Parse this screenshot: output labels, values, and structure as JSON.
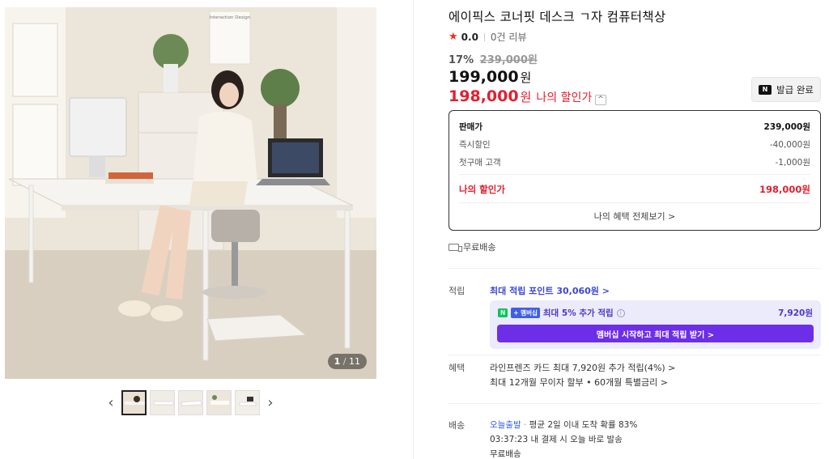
{
  "product": {
    "title": "에이픽스 코너핏 데스크 ㄱ자 컴퓨터책상",
    "rating_star": "★",
    "rating": "0.0",
    "reviews": "0건 리뷰",
    "discount_rate": "17%",
    "original_price": "239,000원",
    "price": "199,000",
    "price_unit": "원",
    "my_price": "198,000",
    "my_price_unit": "원",
    "my_price_label": "나의 할인가",
    "my_price_caret": "^"
  },
  "coupon": {
    "icon": "N",
    "label": "발급 완료"
  },
  "price_box": {
    "rows": [
      {
        "label": "판매가",
        "value": "239,000원"
      },
      {
        "label": "즉시할인",
        "value": "-40,000원"
      },
      {
        "label": "첫구매 고객",
        "value": "-1,000원"
      }
    ],
    "total_label": "나의 할인가",
    "total_value": "198,000원",
    "more_link": "나의 혜택 전체보기 >"
  },
  "shipping_top": "무료배송",
  "points": {
    "label": "적립",
    "max_link": "최대 적립 포인트 30,060원 >",
    "badge_n": "N",
    "badge_plus": "+ 멤버십",
    "member_text": "최대 5% 추가 적립",
    "member_info": "i",
    "member_amount": "7,920원",
    "member_button": "멤버십 시작하고 최대 적립 받기 >"
  },
  "benefits": {
    "label": "혜택",
    "lines": [
      "라인프렌즈 카드 최대 7,920원 추가 적립(4%) >",
      "최대 12개월 무이자 할부 • 60개월 특별금리 >"
    ]
  },
  "delivery": {
    "label": "배송",
    "type": "오늘출발",
    "dot": "·",
    "eta": "평균 2일 이내 도착 확률 83%",
    "countdown": "03:37:23",
    "countdown_text": "내 결제 시 오늘 바로 발송",
    "free": "무료배송"
  },
  "gallery": {
    "current": "1",
    "separator": "/",
    "total": "11",
    "prev": "‹",
    "next": "›",
    "poster_text": "Interaction Design"
  },
  "colors": {
    "sale_red": "#e0202f",
    "membership_purple": "#6d2ee8",
    "link_blue": "#3b47d6",
    "naver_green": "#03c75a"
  }
}
